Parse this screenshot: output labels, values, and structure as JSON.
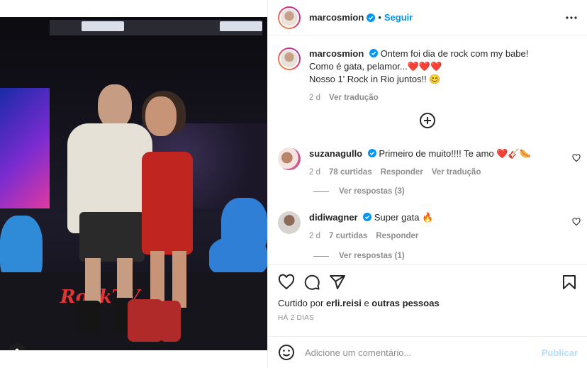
{
  "post": {
    "author": "marcosmion",
    "follow_label": "Seguir",
    "dot": "•",
    "caption_line1": "Ontem foi dia de rock com my babe!",
    "caption_line2": "Como é gata, pelamor...",
    "caption_hearts": "❤️❤️❤️",
    "caption_line3": "Nosso 1' Rock in Rio juntos!! 😊",
    "age": "2 d",
    "translate_label": "Ver tradução",
    "floor_logo": "RockTV"
  },
  "comments": [
    {
      "user": "suzanagullo",
      "text": "Primeiro de muito!!!! Te amo ❤️🎸🌭",
      "age": "2 d",
      "likes": "78 curtidas",
      "reply_label": "Responder",
      "translate_label": "Ver tradução",
      "replies_label": "Ver respostas (3)"
    },
    {
      "user": "didiwagner",
      "text": "Super gata 🔥",
      "age": "2 d",
      "likes": "7 curtidas",
      "reply_label": "Responder",
      "replies_label": "Ver respostas (1)"
    }
  ],
  "likes": {
    "prefix": "Curtido por",
    "user": "erli.reisi",
    "connector": "e",
    "others": "outras pessoas"
  },
  "timestamp": "HÁ 2 DIAS",
  "add_comment": {
    "placeholder": "Adicione um comentário...",
    "publish_label": "Publicar"
  },
  "colors": {
    "accent": "#0095f6",
    "publish_disabled": "#b2dffc",
    "muted": "#8e8e8e",
    "text": "#262626"
  },
  "icons": [
    "verified-icon",
    "more-icon",
    "add-circle-icon",
    "heart-icon",
    "comment-icon",
    "share-icon",
    "bookmark-icon",
    "emoji-icon",
    "user-tag-icon"
  ]
}
